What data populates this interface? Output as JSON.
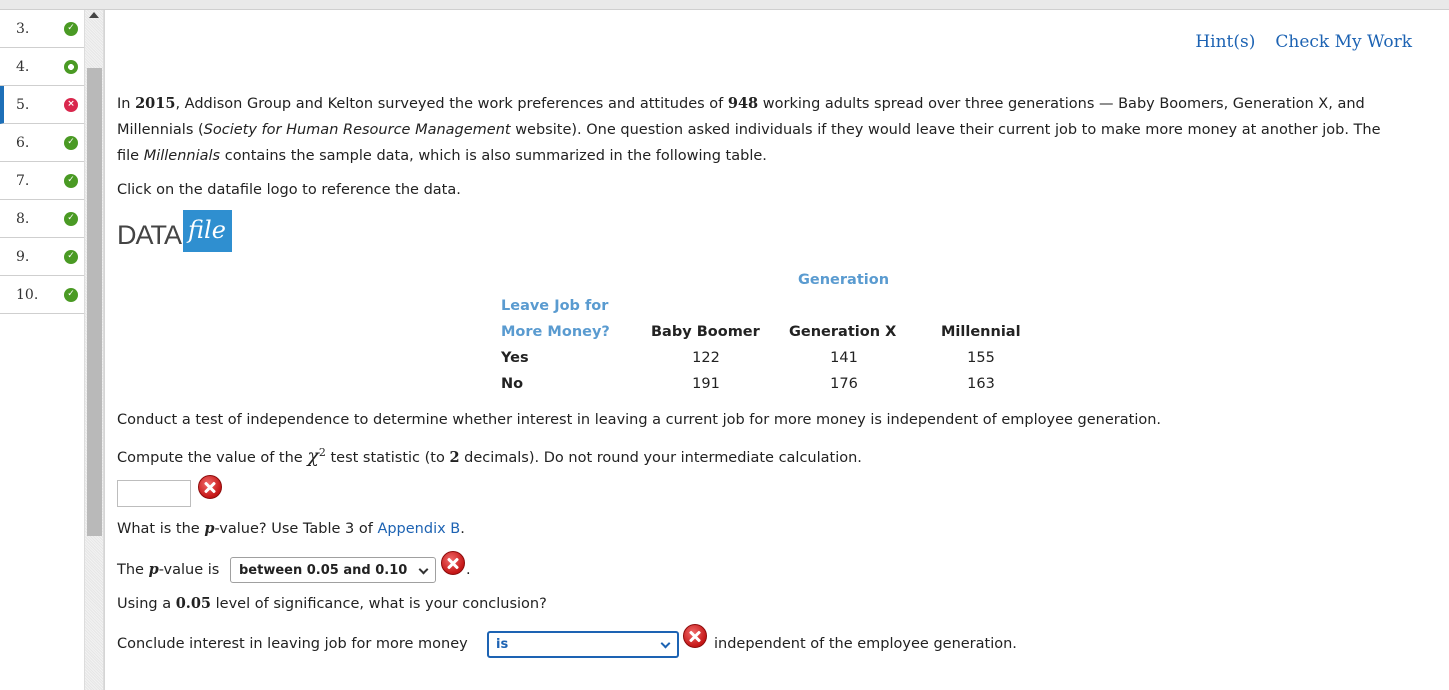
{
  "nav": {
    "items": [
      {
        "num": "3.",
        "status": "correct"
      },
      {
        "num": "4.",
        "status": "partial"
      },
      {
        "num": "5.",
        "status": "wrong"
      },
      {
        "num": "6.",
        "status": "correct"
      },
      {
        "num": "7.",
        "status": "correct"
      },
      {
        "num": "8.",
        "status": "correct"
      },
      {
        "num": "9.",
        "status": "correct"
      },
      {
        "num": "10.",
        "status": "correct"
      }
    ]
  },
  "header": {
    "hint_label": "Hint(s)",
    "check_label": "Check My Work"
  },
  "intro": {
    "t1": "In ",
    "year": "2015",
    "t2": ", Addison Group and Kelton surveyed the work preferences and attitudes of ",
    "n": "948",
    "t3": " working adults spread over three generations — Baby Boomers, Generation X, and",
    "line2a": "Millennials (",
    "source": "Society for Human Resource Management",
    "line2b": " website). One question asked individuals if they would leave their current job to make more money at another job. The",
    "line3a": "file ",
    "file": "Millennials",
    "line3b": " contains the sample data, which is also summarized in the following table."
  },
  "click_text": "Click on the datafile logo to reference the data.",
  "logo": {
    "data": "DATA",
    "file": "file"
  },
  "table": {
    "group_header": "Generation",
    "row_header_1": "Leave Job for",
    "row_header_2": "More Money?",
    "columns": [
      "Baby Boomer",
      "Generation X",
      "Millennial"
    ],
    "rows": [
      {
        "label": "Yes",
        "values": [
          "122",
          "141",
          "155"
        ]
      },
      {
        "label": "No",
        "values": [
          "191",
          "176",
          "163"
        ]
      }
    ]
  },
  "q1": {
    "text": "Conduct a test of independence to determine whether interest in leaving a current job for more money is independent of employee generation."
  },
  "q2": {
    "a": "Compute the value of the ",
    "chi": "χ",
    "sup": "2",
    "b": " test statistic (to ",
    "dec": "2",
    "c": " decimals). Do not round your intermediate calculation.",
    "value": ""
  },
  "q3": {
    "a": "What is the ",
    "p": "p",
    "b": "-value? Use Table 3 of ",
    "link": "Appendix B",
    "c": "."
  },
  "q4": {
    "a": "The ",
    "p": "p",
    "b": "-value is ",
    "selected": "between 0.05 and 0.10",
    "c": "."
  },
  "q5": {
    "a": "Using a ",
    "level": "0.05",
    "b": " level of significance, what is your conclusion?"
  },
  "q6": {
    "a": "Conclude interest in leaving job for more money",
    "selected": "is",
    "b": "independent of the employee generation."
  },
  "colors": {
    "accent": "#1d63b3",
    "correct": "#4a9a24",
    "wrong": "#d9274d",
    "header_blue": "#5a9bd0"
  }
}
